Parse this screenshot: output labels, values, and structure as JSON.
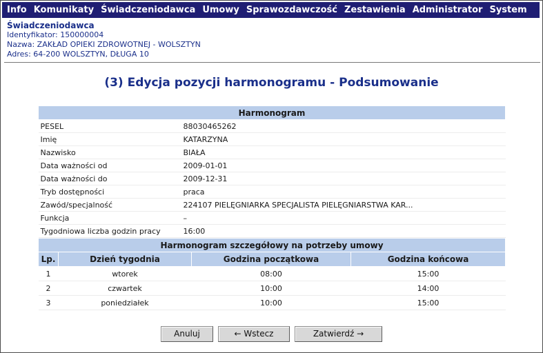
{
  "menu": [
    "Info",
    "Komunikaty",
    "Świadczeniodawca",
    "Umowy",
    "Sprawozdawczość",
    "Zestawienia",
    "Administrator",
    "System"
  ],
  "provider": {
    "title": "Świadczeniodawca",
    "id_line": "Identyfikator: 150000004",
    "name_line": "Nazwa: ZAKŁAD OPIEKI ZDROWOTNEJ - WOLSZTYN",
    "address_line": "Adres: 64-200 WOLSZTYN, DŁUGA 10"
  },
  "page_title": "(3) Edycja pozycji harmonogramu - Podsumowanie",
  "harmonogram": {
    "header": "Harmonogram",
    "fields": [
      {
        "label": "PESEL",
        "value": "88030465262"
      },
      {
        "label": "Imię",
        "value": "KATARZYNA"
      },
      {
        "label": "Nazwisko",
        "value": "BIAŁA"
      },
      {
        "label": "Data ważności od",
        "value": "2009-01-01"
      },
      {
        "label": "Data ważności do",
        "value": "2009-12-31"
      },
      {
        "label": "Tryb dostępności",
        "value": "praca"
      },
      {
        "label": "Zawód/specjalność",
        "value": "224107 PIELĘGNIARKA SPECJALISTA PIELĘGNIARSTWA KAR..."
      },
      {
        "label": "Funkcja",
        "value": "–"
      },
      {
        "label": "Tygodniowa liczba godzin pracy",
        "value": "16:00"
      }
    ]
  },
  "detail": {
    "header": "Harmonogram szczegółowy na potrzeby umowy",
    "columns": [
      "Lp.",
      "Dzień tygodnia",
      "Godzina początkowa",
      "Godzina końcowa"
    ],
    "rows": [
      [
        "1",
        "wtorek",
        "08:00",
        "15:00"
      ],
      [
        "2",
        "czwartek",
        "10:00",
        "14:00"
      ],
      [
        "3",
        "poniedziałek",
        "10:00",
        "15:00"
      ]
    ]
  },
  "buttons": {
    "cancel": "Anuluj",
    "back": "← Wstecz",
    "confirm": "Zatwierdź →"
  }
}
